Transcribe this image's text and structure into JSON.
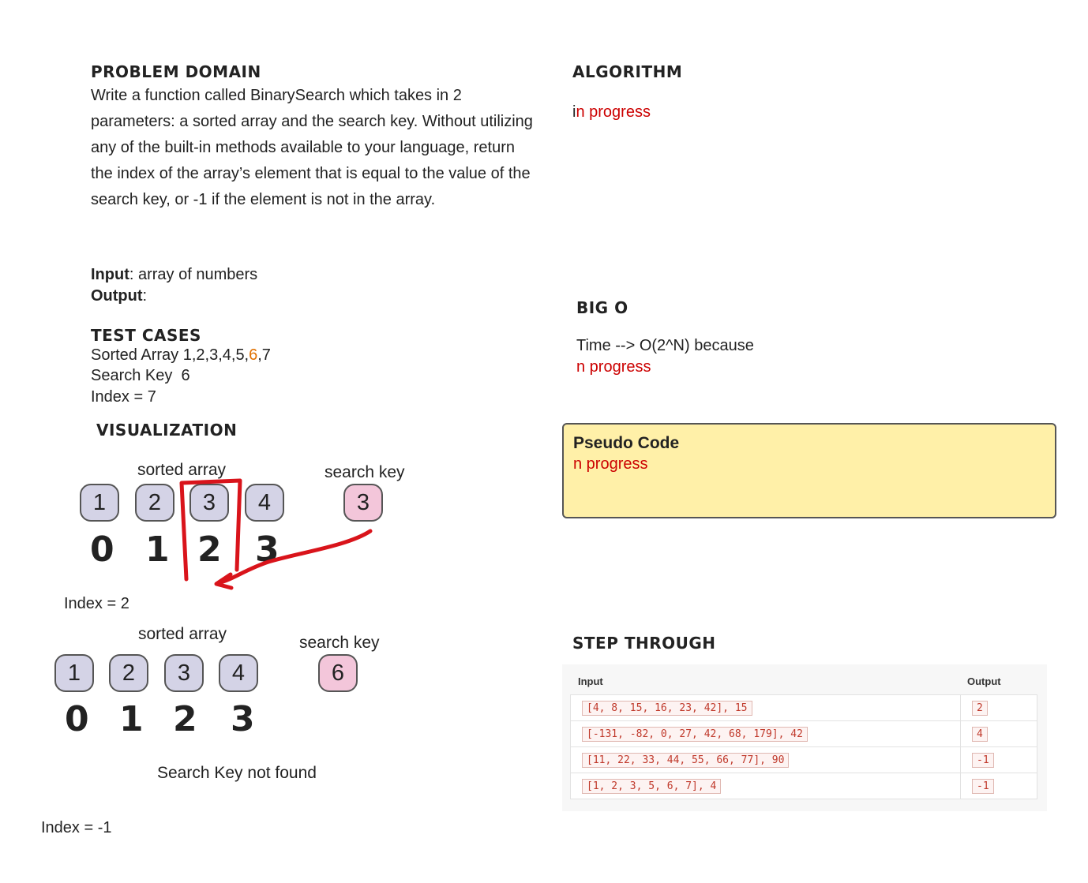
{
  "problem_domain": {
    "heading": "PROBLEM DOMAIN",
    "text": "Write a function called BinarySearch which takes in 2 parameters: a sorted array and the search key. Without utilizing any of the built-in methods available to your language, return the index of the array’s element that is equal to the value of the search key, or -1 if the element is not in the array.",
    "input_label": "Input",
    "input_value": ": array of numbers",
    "output_label": "Output",
    "output_value": ":"
  },
  "test_cases": {
    "heading": "TEST CASES",
    "sorted_prefix": "Sorted Array 1,2,3,4,5,",
    "sorted_highlight": "6",
    "sorted_suffix": ",7",
    "search_key": "Search Key  6",
    "index": "Index = 7"
  },
  "visualization": {
    "heading": "VISUALIZATION",
    "example1": {
      "array_label": "sorted array",
      "key_label": "search key",
      "values": [
        "1",
        "2",
        "3",
        "4"
      ],
      "indices": [
        "0",
        "1",
        "2",
        "3"
      ],
      "key": "3",
      "result": "Index = 2"
    },
    "example2": {
      "array_label": "sorted array",
      "key_label": "search key",
      "values": [
        "1",
        "2",
        "3",
        "4"
      ],
      "indices": [
        "0",
        "1",
        "2",
        "3"
      ],
      "key": "6",
      "message": "Search Key not found",
      "result": "Index = -1"
    },
    "colors": {
      "node": "#d4d3e6",
      "key_node": "#f3c6da",
      "annotation": "#d9141b"
    }
  },
  "algorithm": {
    "heading": "ALGORITHM",
    "first_letter": "i",
    "rest": "n progress"
  },
  "big_o": {
    "heading": "BIG O",
    "time": "Time --> O(2^N) because",
    "status": "n progress"
  },
  "pseudo_code": {
    "title": "Pseudo Code",
    "body": "n progress"
  },
  "step_through": {
    "heading": "STEP THROUGH",
    "columns": [
      "Input",
      "Output"
    ],
    "rows": [
      {
        "input": "[4, 8, 15, 16, 23, 42], 15",
        "output": "2"
      },
      {
        "input": "[-131, -82, 0, 27, 42, 68, 179], 42",
        "output": "4"
      },
      {
        "input": "[11, 22, 33, 44, 55, 66, 77], 90",
        "output": "-1"
      },
      {
        "input": "[1, 2, 3, 5, 6, 7], 4",
        "output": "-1"
      }
    ]
  }
}
